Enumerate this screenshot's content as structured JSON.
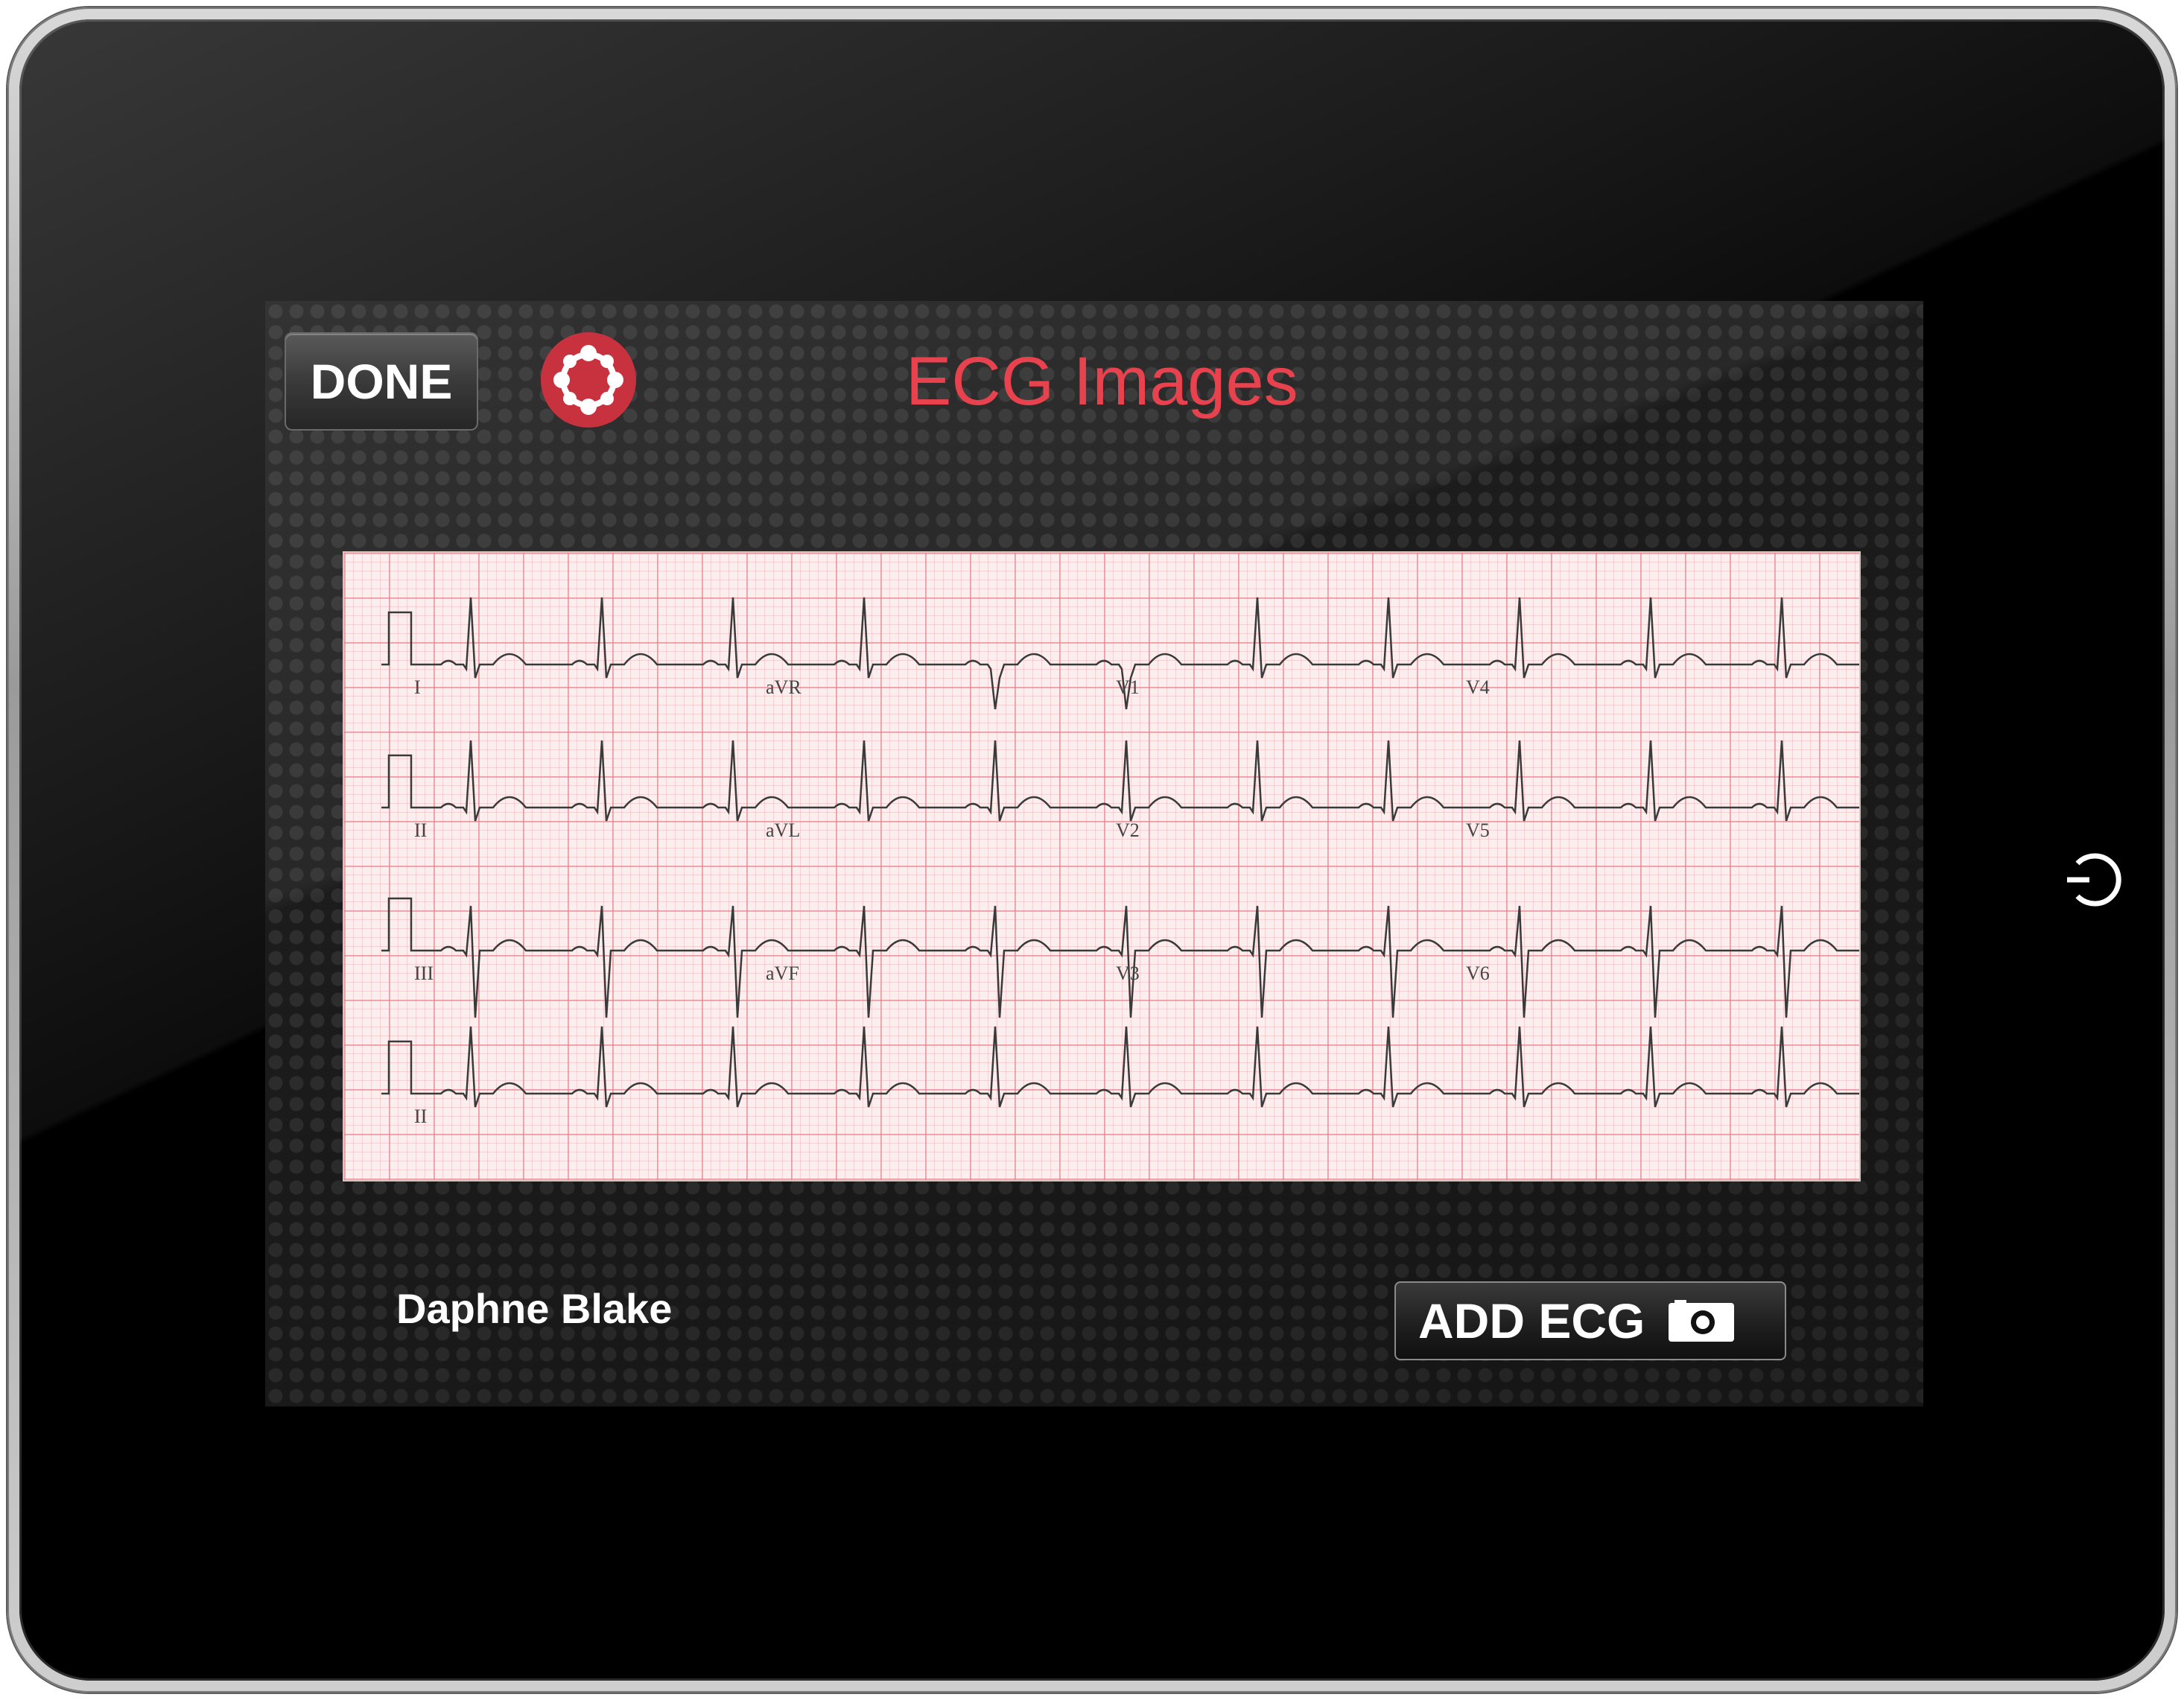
{
  "header": {
    "done_label": "DONE",
    "title": "ECG Images",
    "title_color": "#e8424e"
  },
  "logo_icon": "lifebuoy-icon",
  "ecg": {
    "lead_labels": [
      "I",
      "aVR",
      "V1",
      "V4",
      "II",
      "aVL",
      "V2",
      "V5",
      "III",
      "aVF",
      "V3",
      "V6",
      "II"
    ]
  },
  "patient": {
    "name": "Daphne Blake"
  },
  "footer": {
    "add_ecg_label": "ADD ECG",
    "add_ecg_icon": "camera-icon"
  },
  "device": {
    "home_icon": "power-icon"
  }
}
